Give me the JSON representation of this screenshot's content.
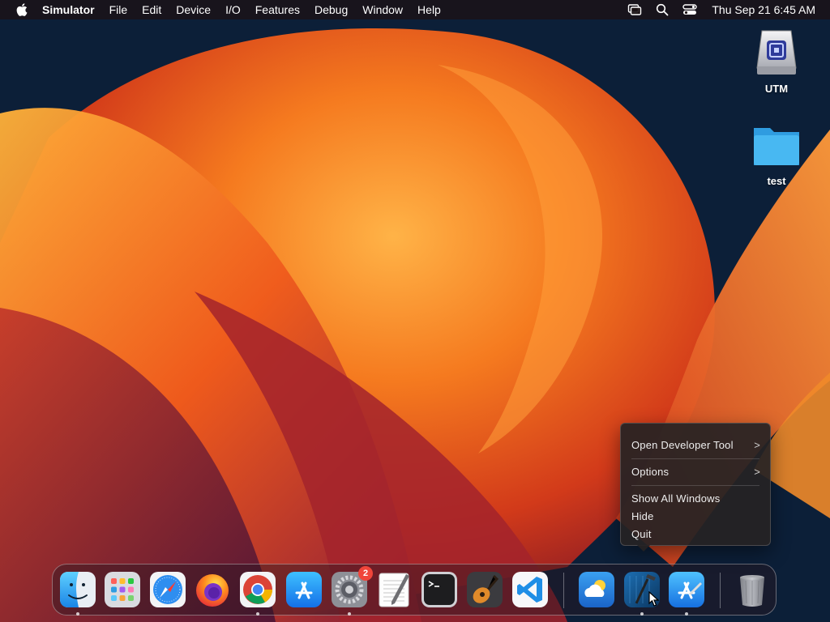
{
  "menubar": {
    "app_name": "Simulator",
    "items": [
      "File",
      "Edit",
      "Device",
      "I/O",
      "Features",
      "Debug",
      "Window",
      "Help"
    ],
    "clock": "Thu Sep 21  6:45 AM"
  },
  "desktop": {
    "icons": [
      {
        "label": "UTM",
        "icon": "disk-drive-icon"
      },
      {
        "label": "test",
        "icon": "folder-icon"
      }
    ]
  },
  "dock": {
    "apps": [
      {
        "name": "Finder",
        "icon": "finder-icon",
        "running": true
      },
      {
        "name": "Launchpad",
        "icon": "launchpad-icon",
        "running": false
      },
      {
        "name": "Safari",
        "icon": "safari-icon",
        "running": false
      },
      {
        "name": "Firefox",
        "icon": "firefox-icon",
        "running": false
      },
      {
        "name": "Chrome",
        "icon": "chrome-icon",
        "running": true
      },
      {
        "name": "App Store",
        "icon": "app-store-icon",
        "running": false
      },
      {
        "name": "System Settings",
        "icon": "settings-gear-icon",
        "running": true,
        "badge": "2"
      },
      {
        "name": "TextEdit",
        "icon": "textedit-icon",
        "running": false
      },
      {
        "name": "Terminal",
        "icon": "terminal-icon",
        "running": false
      },
      {
        "name": "GarageBand",
        "icon": "garageband-icon",
        "running": false
      },
      {
        "name": "Visual Studio Code",
        "icon": "vscode-icon",
        "running": false
      },
      {
        "name": "Weather",
        "icon": "weather-icon",
        "running": false
      },
      {
        "name": "Xcode",
        "icon": "xcode-icon",
        "running": true
      },
      {
        "name": "Simulator",
        "icon": "simulator-icon",
        "running": true
      },
      {
        "name": "Trash",
        "icon": "trash-icon",
        "running": false
      }
    ]
  },
  "context_menu": {
    "open_developer_tool": "Open Developer Tool",
    "options": "Options",
    "show_all_windows": "Show All Windows",
    "hide": "Hide",
    "quit": "Quit",
    "chevron": ">"
  },
  "colors": {
    "menu_bg": "#1c1214",
    "accent_orange": "#f26a1b",
    "folder_blue": "#3fb4f0",
    "badge_red": "#f0453a"
  }
}
